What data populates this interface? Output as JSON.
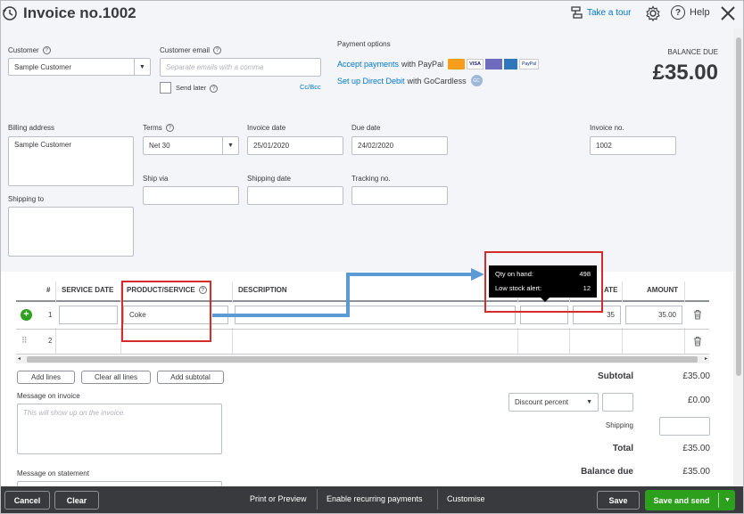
{
  "header": {
    "title": "Invoice no.1002",
    "take_tour": "Take a tour",
    "help": "Help"
  },
  "customer": {
    "label": "Customer",
    "value": "Sample Customer",
    "email_label": "Customer email",
    "email_placeholder": "Separate emails with a comma",
    "send_later": "Send later",
    "cc_bcc": "Cc/Bcc"
  },
  "payment": {
    "label": "Payment options",
    "accept_link": "Accept payments",
    "accept_suffix": "with PayPal",
    "card_logos": [
      "mastercard-icon",
      "visa-icon",
      "maestro-icon",
      "amex-icon",
      "paypal-icon"
    ],
    "direct_debit_link": "Set up Direct Debit",
    "direct_debit_suffix": "with GoCardless"
  },
  "balance": {
    "label": "BALANCE DUE",
    "amount": "£35.00"
  },
  "billing": {
    "billing_label": "Billing address",
    "billing_value": "Sample Customer",
    "terms_label": "Terms",
    "terms_value": "Net 30",
    "invoice_date_label": "Invoice date",
    "invoice_date_value": "25/01/2020",
    "due_date_label": "Due date",
    "due_date_value": "24/02/2020",
    "invoice_no_label": "Invoice no.",
    "invoice_no_value": "1002",
    "shipping_to_label": "Shipping to",
    "ship_via_label": "Ship via",
    "shipping_date_label": "Shipping date",
    "tracking_label": "Tracking no."
  },
  "table": {
    "columns": [
      "#",
      "SERVICE DATE",
      "PRODUCT/SERVICE",
      "DESCRIPTION",
      "ATE",
      "AMOUNT"
    ],
    "rows": [
      {
        "num": "1",
        "product": "Coke",
        "rate": "35",
        "amount": "35.00"
      },
      {
        "num": "2",
        "product": "",
        "rate": "",
        "amount": ""
      }
    ]
  },
  "tooltip": {
    "qty_label": "Qty on hand:",
    "qty_value": "498",
    "low_label": "Low stock alert:",
    "low_value": "12"
  },
  "actions": {
    "add_lines": "Add lines",
    "clear_all_lines": "Clear all lines",
    "add_subtotal": "Add subtotal"
  },
  "messages": {
    "invoice_label": "Message on invoice",
    "invoice_placeholder": "This will show up on the invoice.",
    "statement_label": "Message on statement"
  },
  "totals": {
    "subtotal_label": "Subtotal",
    "subtotal_value": "£35.00",
    "discount_select": "Discount percent",
    "discount_value": "£0.00",
    "shipping_label": "Shipping",
    "total_label": "Total",
    "total_value": "£35.00",
    "balance_due_label": "Balance due",
    "balance_due_value": "£35.00"
  },
  "toolbar": {
    "cancel": "Cancel",
    "clear": "Clear",
    "print_preview": "Print or Preview",
    "recurring": "Enable recurring payments",
    "customise": "Customise",
    "save": "Save",
    "save_send": "Save and send"
  },
  "colors": {
    "brand_green": "#2ca01c",
    "link_blue": "#0077c5",
    "toolbar_bg": "#393a3d",
    "annotation_red": "#d52b2b",
    "annotation_arrow": "#5b9bd5"
  }
}
